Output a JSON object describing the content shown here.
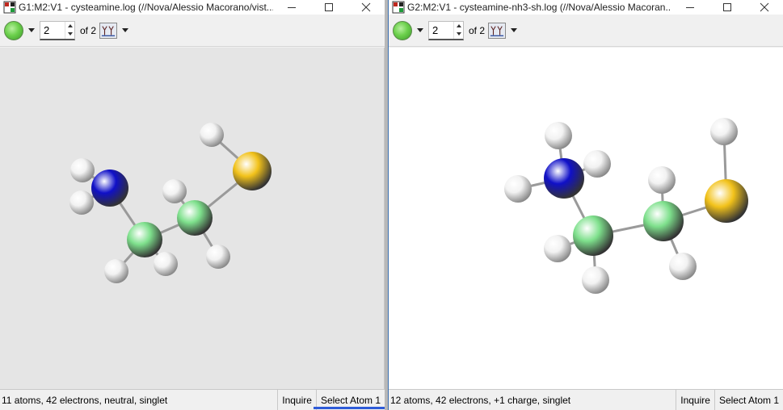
{
  "windows": [
    {
      "title": "G1:M2:V1 - cysteamine.log (//Nova/Alessio Macorano/vist...",
      "model_label": "of 2",
      "model_value": "2",
      "status_text": "11 atoms, 42 electrons, neutral, singlet",
      "status_mode": "Inquire",
      "status_action": "Select Atom 1"
    },
    {
      "title": "G2:M2:V1 - cysteamine-nh3-sh.log (//Nova/Alessio Macoran...",
      "model_label": "of 2",
      "model_value": "2",
      "status_text": "12 atoms, 42 electrons, +1 charge, singlet",
      "status_mode": "Inquire",
      "status_action": "Select Atom 1"
    }
  ],
  "colors": {
    "hydrogen": "#f2f2f2",
    "nitrogen": "#1010c8",
    "carbon": "#7ee08c",
    "sulfur": "#f2c21a",
    "bond": "#9a9a9a",
    "viewport_left_bg": "#e5e5e5",
    "viewport_right_bg": "#ffffff"
  },
  "icons": {
    "app": "gaussview-app-icon",
    "minimize": "minimize-icon",
    "maximize": "maximize-icon",
    "close": "close-icon",
    "element_ball": "element-color-ball",
    "frame_select": "frame-selector-icon"
  }
}
